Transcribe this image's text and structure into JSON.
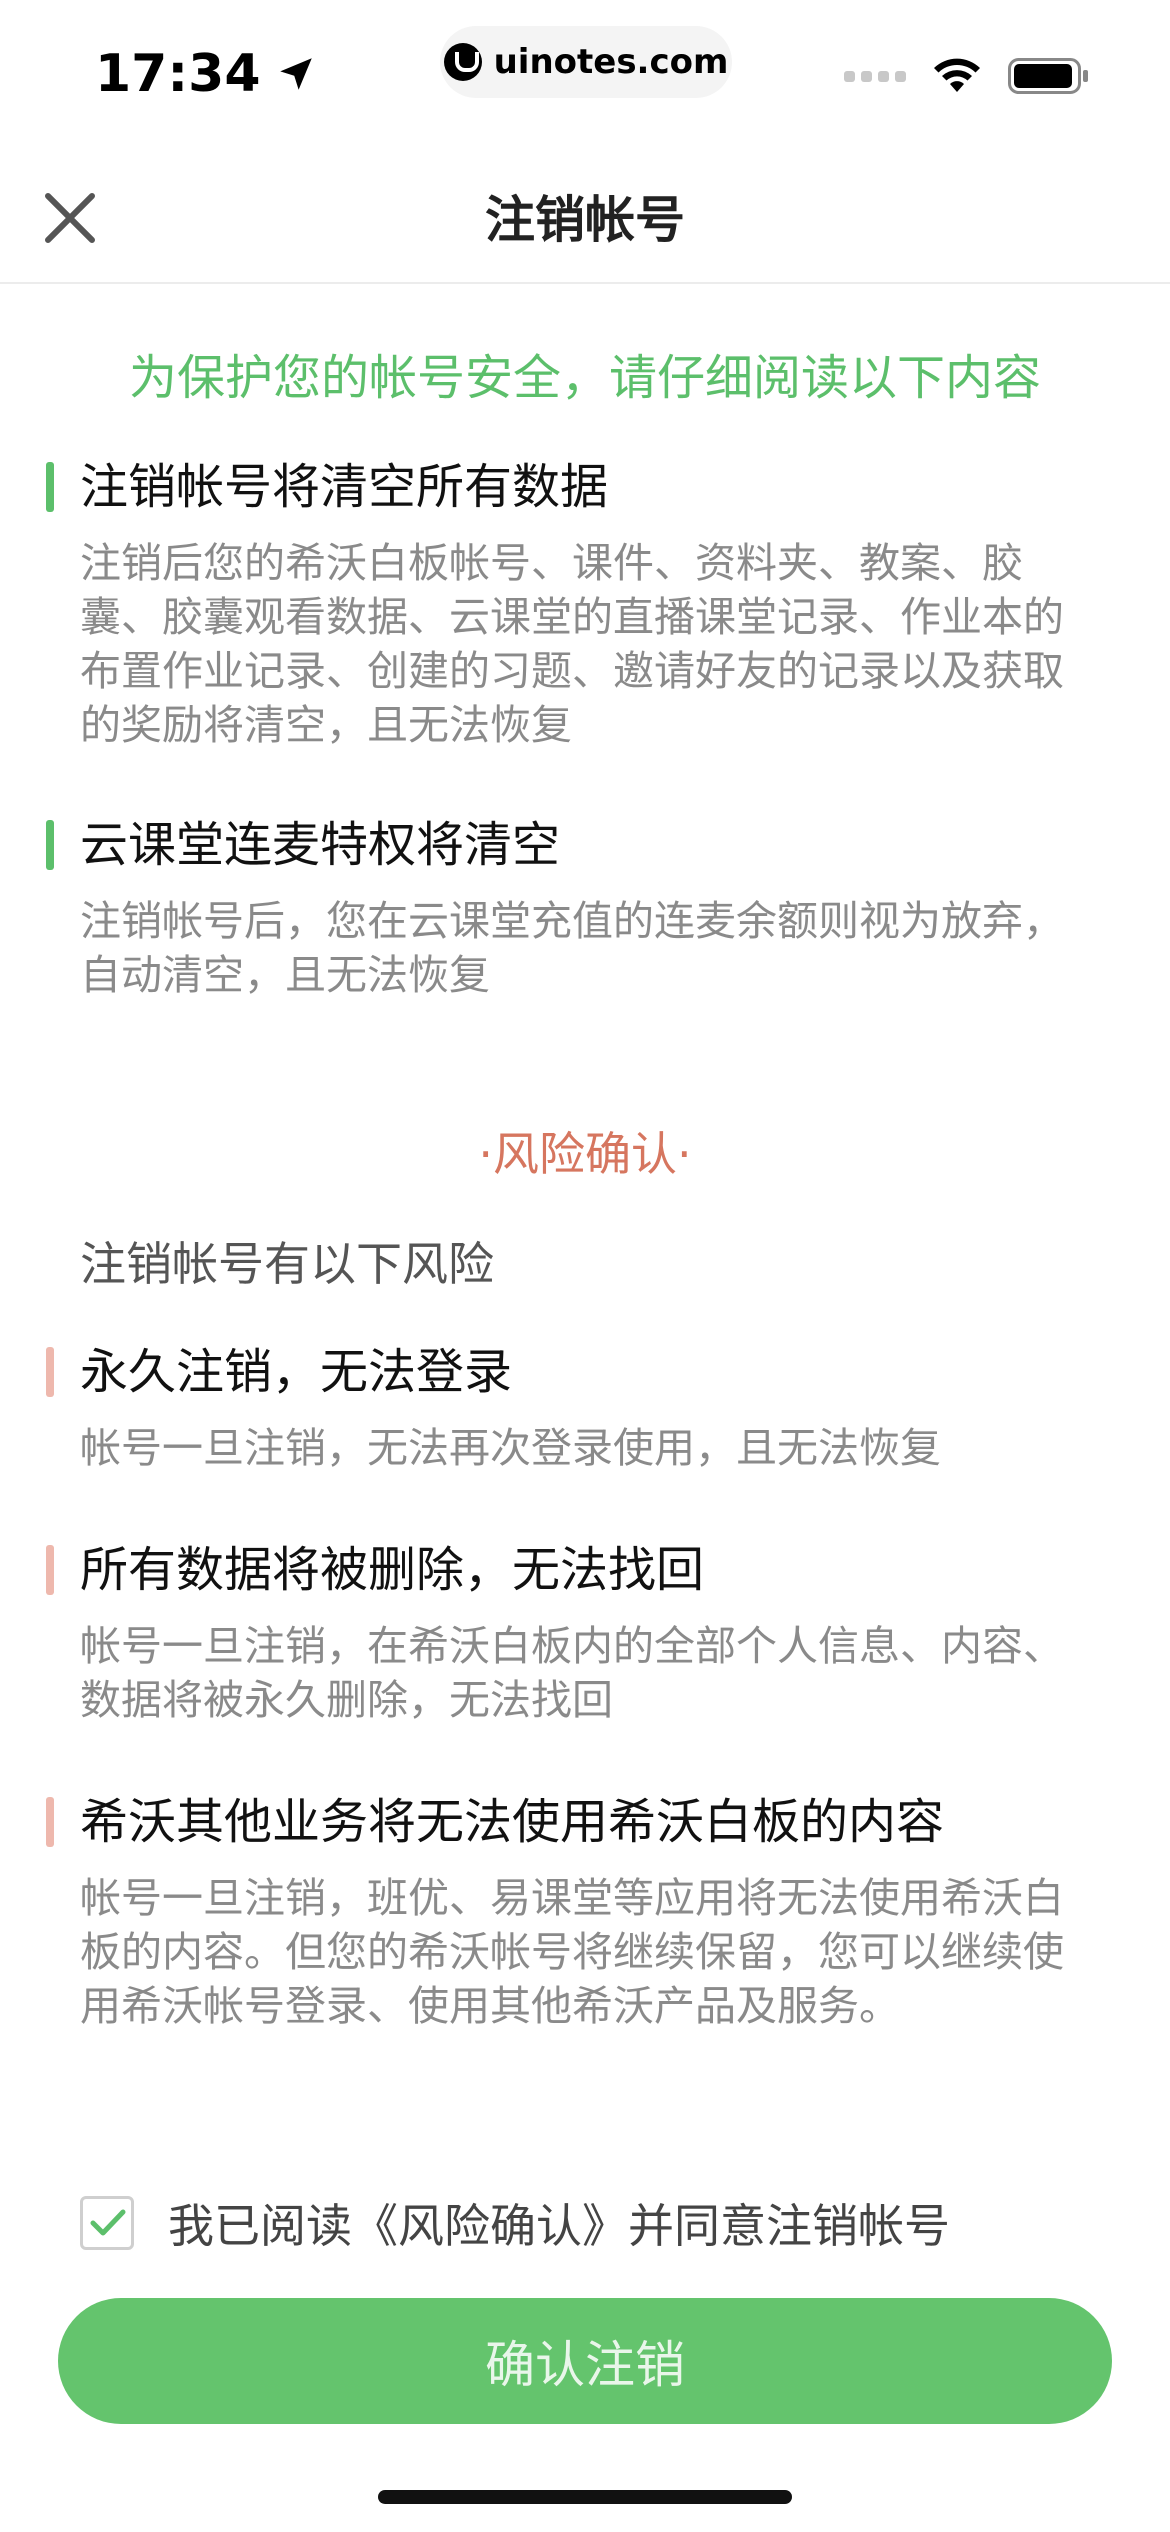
{
  "status_bar": {
    "time": "17:34",
    "url": "uinotes.com"
  },
  "nav": {
    "title": "注销帐号"
  },
  "notice": {
    "headline": "为保护您的帐号安全，请仔细阅读以下内容",
    "sections": [
      {
        "title": "注销帐号将清空所有数据",
        "body": "注销后您的希沃白板帐号、课件、资料夹、教案、胶囊、胶囊观看数据、云课堂的直播课堂记录、作业本的布置作业记录、创建的习题、邀请好友的记录以及获取的奖励将清空，且无法恢复"
      },
      {
        "title": "云课堂连麦特权将清空",
        "body": "注销帐号后，您在云课堂充值的连麦余额则视为放弃，自动清空，且无法恢复"
      }
    ]
  },
  "risk": {
    "heading": "·风险确认·",
    "subtitle": "注销帐号有以下风险",
    "items": [
      {
        "title": "永久注销，无法登录",
        "body": "帐号一旦注销，无法再次登录使用，且无法恢复"
      },
      {
        "title": "所有数据将被删除，无法找回",
        "body": "帐号一旦注销，在希沃白板内的全部个人信息、内容、数据将被永久删除，无法找回"
      },
      {
        "title": "希沃其他业务将无法使用希沃白板的内容",
        "body": "帐号一旦注销，班优、易课堂等应用将无法使用希沃白板的内容。但您的希沃帐号将继续保留，您可以继续使用希沃帐号登录、使用其他希沃产品及服务。"
      }
    ]
  },
  "agreement": {
    "label": "我已阅读《风险确认》并同意注销帐号",
    "checked": true
  },
  "confirm_button": {
    "label": "确认注销"
  },
  "colors": {
    "accent_green": "#5cbf6b",
    "risk_red": "#d6765f",
    "button_green": "#64c46d"
  }
}
